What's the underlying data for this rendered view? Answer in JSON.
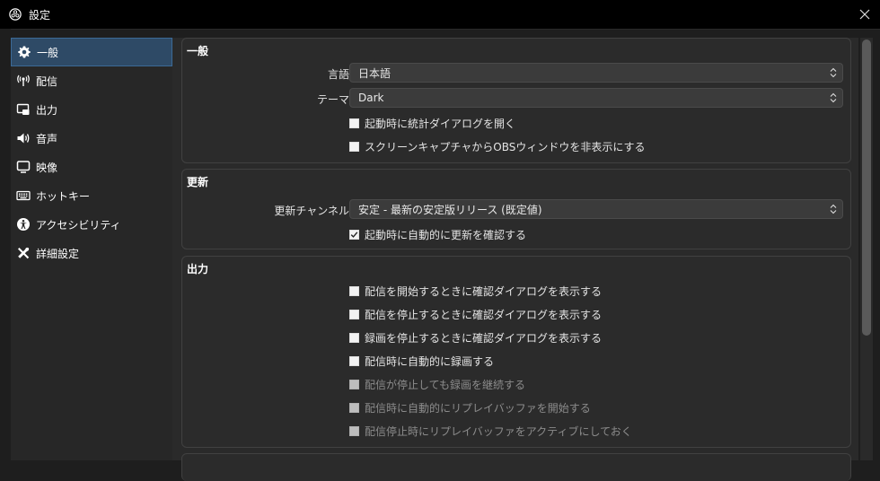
{
  "window": {
    "title": "設定"
  },
  "sidebar": {
    "items": [
      {
        "label": "一般",
        "icon": "gear-icon",
        "active": true
      },
      {
        "label": "配信",
        "icon": "broadcast-icon",
        "active": false
      },
      {
        "label": "出力",
        "icon": "output-icon",
        "active": false
      },
      {
        "label": "音声",
        "icon": "speaker-icon",
        "active": false
      },
      {
        "label": "映像",
        "icon": "monitor-icon",
        "active": false
      },
      {
        "label": "ホットキー",
        "icon": "keyboard-icon",
        "active": false
      },
      {
        "label": "アクセシビリティ",
        "icon": "accessibility-icon",
        "active": false
      },
      {
        "label": "詳細設定",
        "icon": "tools-icon",
        "active": false
      }
    ]
  },
  "general": {
    "title": "一般",
    "language_label": "言語",
    "language_value": "日本語",
    "theme_label": "テーマ",
    "theme_value": "Dark",
    "checks": [
      {
        "label": "起動時に統計ダイアログを開く",
        "checked": false
      },
      {
        "label": "スクリーンキャプチャからOBSウィンドウを非表示にする",
        "checked": false
      }
    ]
  },
  "update": {
    "title": "更新",
    "channel_label": "更新チャンネル",
    "channel_value": "安定 - 最新の安定版リリース (既定値)",
    "checks": [
      {
        "label": "起動時に自動的に更新を確認する",
        "checked": true
      }
    ]
  },
  "output": {
    "title": "出力",
    "checks": [
      {
        "label": "配信を開始するときに確認ダイアログを表示する",
        "checked": false,
        "disabled": false
      },
      {
        "label": "配信を停止するときに確認ダイアログを表示する",
        "checked": false,
        "disabled": false
      },
      {
        "label": "録画を停止するときに確認ダイアログを表示する",
        "checked": false,
        "disabled": false
      },
      {
        "label": "配信時に自動的に録画する",
        "checked": false,
        "disabled": false
      },
      {
        "label": "配信が停止しても録画を継続する",
        "checked": false,
        "disabled": true
      },
      {
        "label": "配信時に自動的にリプレイバッファを開始する",
        "checked": false,
        "disabled": true
      },
      {
        "label": "配信停止時にリプレイバッファをアクティブにしておく",
        "checked": false,
        "disabled": true
      }
    ]
  },
  "colors": {
    "active_nav": "#2e4a66",
    "panel": "#2b2b2b",
    "background": "#1e1e1e"
  }
}
